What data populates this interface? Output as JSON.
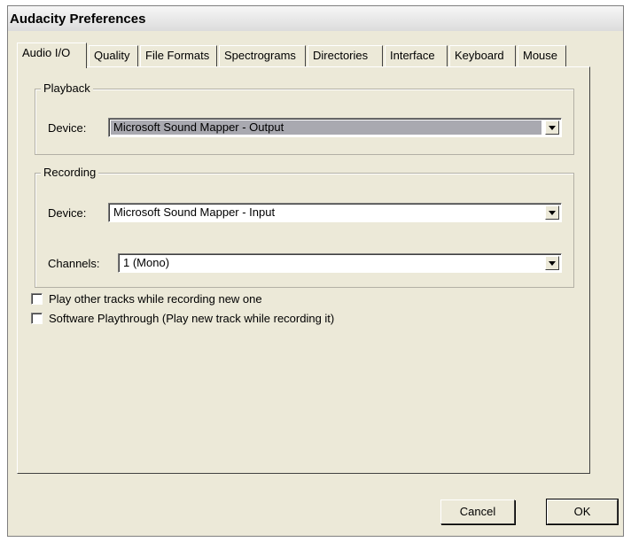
{
  "window": {
    "title": "Audacity Preferences"
  },
  "tabs": [
    {
      "label": "Audio I/O",
      "active": true
    },
    {
      "label": "Quality"
    },
    {
      "label": "File Formats"
    },
    {
      "label": "Spectrograms"
    },
    {
      "label": "Directories"
    },
    {
      "label": "Interface"
    },
    {
      "label": "Keyboard"
    },
    {
      "label": "Mouse"
    }
  ],
  "playback": {
    "group_label": "Playback",
    "device_label": "Device:",
    "device_value": "Microsoft Sound Mapper - Output"
  },
  "recording": {
    "group_label": "Recording",
    "device_label": "Device:",
    "device_value": "Microsoft Sound Mapper - Input",
    "channels_label": "Channels:",
    "channels_value": "1 (Mono)"
  },
  "options": [
    {
      "label": "Play other tracks while recording new one",
      "checked": false
    },
    {
      "label": "Software Playthrough (Play new track while recording it)",
      "checked": false
    }
  ],
  "buttons": {
    "cancel": "Cancel",
    "ok": "OK"
  }
}
